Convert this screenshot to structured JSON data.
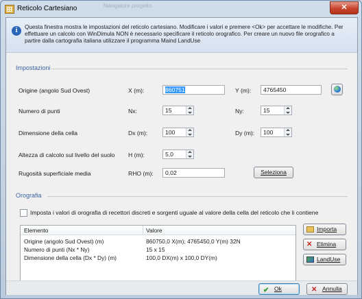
{
  "window": {
    "title": "Reticolo Cartesiano",
    "close_glyph": "✕",
    "background_text": "Navigatore progetto"
  },
  "info": {
    "icon": "info-icon",
    "text": "Questa finestra mostra le impostazioni del reticolo cartesiano. Modificare i valori e premere <Ok> per accettare le modifiche. Per effettuare un calcolo con WinDimula NON è necessario specificare il reticolo orografico. Per creare un nuovo file orografico a partire dalla cartografia italiana utilizzare il programma Maind LandUse"
  },
  "impostazioni": {
    "title": "Impostazioni",
    "origine": {
      "label": "Origine (angolo Sud Ovest)",
      "x_label": "X (m):",
      "x_value": "860751",
      "y_label": "Y (m):",
      "y_value": "4765450"
    },
    "punti": {
      "label": "Numero di punti",
      "nx_label": "Nx:",
      "nx_value": "15",
      "ny_label": "Ny:",
      "ny_value": "15"
    },
    "cella": {
      "label": "Dimensione della cella",
      "dx_label": "Dx (m):",
      "dx_value": "100",
      "dy_label": "Dy (m):",
      "dy_value": "100"
    },
    "altezza": {
      "label": "Altezza di calcolo sul livello del suolo",
      "h_label": "H  (m):",
      "h_value": "5,0"
    },
    "rugosita": {
      "label": "Rugosità superficiale media",
      "rho_label": "RHO (m):",
      "rho_value": "0,02",
      "button": "Seleziona"
    }
  },
  "orografia": {
    "title": "Orografia",
    "checkbox_label": "Imposta i valori di orografia di recettori discreti e sorgenti uguale al valore della cella del reticolo che li contiene",
    "checked": false,
    "columns": [
      "Elemento",
      "Valore"
    ],
    "rows": [
      {
        "elemento": "Origine (angolo Sud Ovest) (m)",
        "valore": "860750,0 X(m); 4765450,0 Y(m) 32N"
      },
      {
        "elemento": "Numero di punti (Nx * Ny)",
        "valore": "15 x 15"
      },
      {
        "elemento": "Dimensione della cella (Dx * Dy) (m)",
        "valore": "100,0 DX(m) x 100,0 DY(m)"
      }
    ],
    "buttons": {
      "importa": "Importa",
      "elimina": "Elimina",
      "landuse": "LandUse"
    }
  },
  "footer": {
    "ok": "Ok",
    "annulla": "Annulla"
  },
  "colors": {
    "section_title": "#3a63a4",
    "selection": "#3399ff",
    "close": "#c8442c"
  }
}
